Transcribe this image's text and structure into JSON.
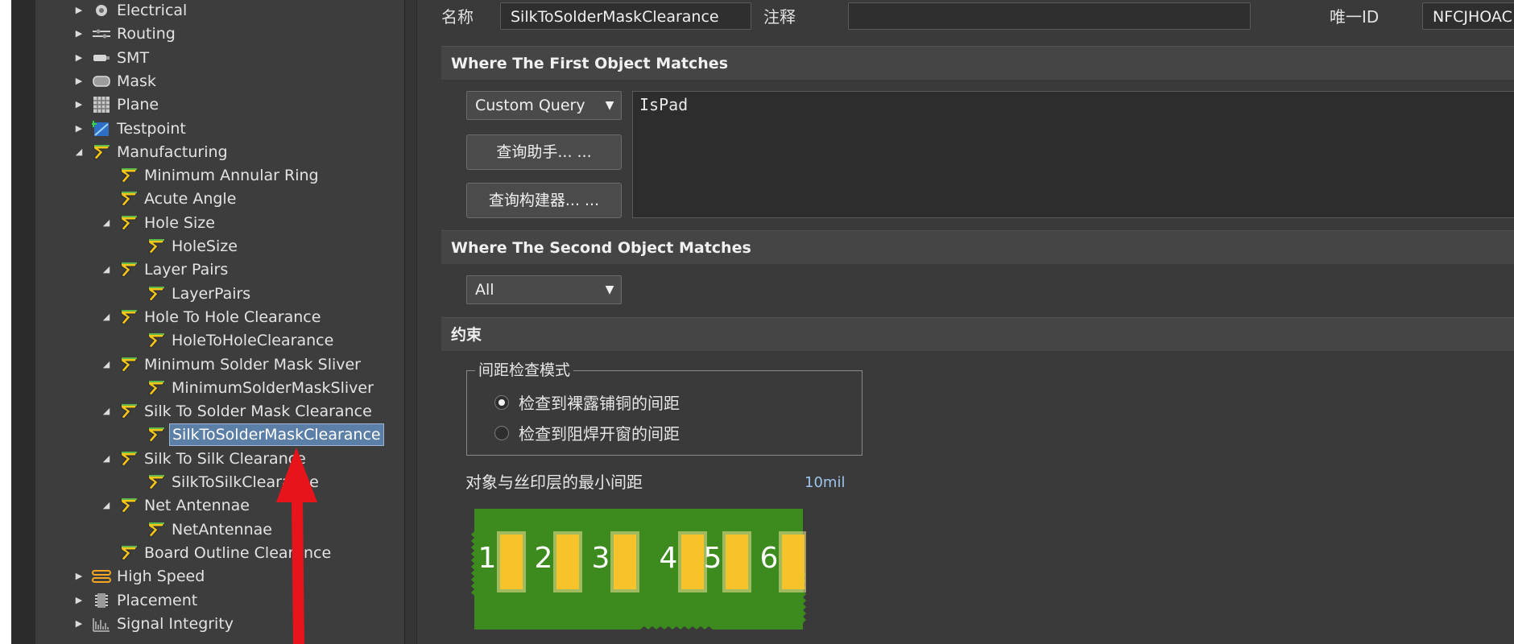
{
  "tree": {
    "items": [
      {
        "label": "Electrical",
        "indent": 0,
        "expander": "▶",
        "icon": "electrical-icon"
      },
      {
        "label": "Routing",
        "indent": 0,
        "expander": "▶",
        "icon": "routing-icon"
      },
      {
        "label": "SMT",
        "indent": 0,
        "expander": "▶",
        "icon": "smt-icon"
      },
      {
        "label": "Mask",
        "indent": 0,
        "expander": "▶",
        "icon": "mask-icon"
      },
      {
        "label": "Plane",
        "indent": 0,
        "expander": "▶",
        "icon": "plane-icon"
      },
      {
        "label": "Testpoint",
        "indent": 0,
        "expander": "▶",
        "icon": "testpoint-icon"
      },
      {
        "label": "Manufacturing",
        "indent": 0,
        "expander": "◢",
        "icon": "rule-icon"
      },
      {
        "label": "Minimum Annular Ring",
        "indent": 1,
        "expander": "",
        "icon": "rule-icon"
      },
      {
        "label": "Acute Angle",
        "indent": 1,
        "expander": "",
        "icon": "rule-icon"
      },
      {
        "label": "Hole Size",
        "indent": 1,
        "expander": "◢",
        "icon": "rule-icon"
      },
      {
        "label": "HoleSize",
        "indent": 2,
        "expander": "",
        "icon": "rule-icon"
      },
      {
        "label": "Layer Pairs",
        "indent": 1,
        "expander": "◢",
        "icon": "rule-icon"
      },
      {
        "label": "LayerPairs",
        "indent": 2,
        "expander": "",
        "icon": "rule-icon"
      },
      {
        "label": "Hole To Hole Clearance",
        "indent": 1,
        "expander": "◢",
        "icon": "rule-icon"
      },
      {
        "label": "HoleToHoleClearance",
        "indent": 2,
        "expander": "",
        "icon": "rule-icon"
      },
      {
        "label": "Minimum Solder Mask Sliver",
        "indent": 1,
        "expander": "◢",
        "icon": "rule-icon"
      },
      {
        "label": "MinimumSolderMaskSliver",
        "indent": 2,
        "expander": "",
        "icon": "rule-icon"
      },
      {
        "label": "Silk To Solder Mask Clearance",
        "indent": 1,
        "expander": "◢",
        "icon": "rule-icon"
      },
      {
        "label": "SilkToSolderMaskClearance",
        "indent": 2,
        "expander": "",
        "icon": "rule-icon",
        "selected": true
      },
      {
        "label": "Silk To Silk Clearance",
        "indent": 1,
        "expander": "◢",
        "icon": "rule-icon"
      },
      {
        "label": "SilkToSilkClearance",
        "indent": 2,
        "expander": "",
        "icon": "rule-icon"
      },
      {
        "label": "Net Antennae",
        "indent": 1,
        "expander": "◢",
        "icon": "rule-icon"
      },
      {
        "label": "NetAntennae",
        "indent": 2,
        "expander": "",
        "icon": "rule-icon"
      },
      {
        "label": "Board Outline Clearance",
        "indent": 1,
        "expander": "",
        "icon": "rule-icon"
      },
      {
        "label": "High Speed",
        "indent": 0,
        "expander": "▶",
        "icon": "high-speed-icon"
      },
      {
        "label": "Placement",
        "indent": 0,
        "expander": "▶",
        "icon": "placement-icon"
      },
      {
        "label": "Signal Integrity",
        "indent": 0,
        "expander": "▶",
        "icon": "signal-integrity-icon"
      }
    ]
  },
  "header": {
    "name_label": "名称",
    "name_value": "SilkToSolderMaskClearance",
    "comment_label": "注释",
    "comment_value": "",
    "uid_label": "唯一ID",
    "uid_value": "NFCJHOAC"
  },
  "first_match": {
    "title": "Where The First Object Matches",
    "combo": "Custom Query",
    "helper_button": "查询助手... ...",
    "builder_button": "查询构建器... ...",
    "query": "IsPad"
  },
  "second_match": {
    "title": "Where The Second Object Matches",
    "combo": "All"
  },
  "constraints": {
    "title": "约束",
    "group_title": "间距检查模式",
    "option1": "检查到裸露铺铜的间距",
    "option2": "检查到阻焊开窗的间距",
    "selected_option": 1,
    "min_label": "对象与丝印层的最小间距",
    "min_value": "10mil",
    "pads": [
      "1",
      "2",
      "3",
      "4",
      "5",
      "6"
    ]
  },
  "colors": {
    "board_green": "#3d8a1e",
    "pad_yellow": "#f6c42a",
    "selection_blue": "#5b7fa6",
    "arrow_red": "#e8141b"
  }
}
